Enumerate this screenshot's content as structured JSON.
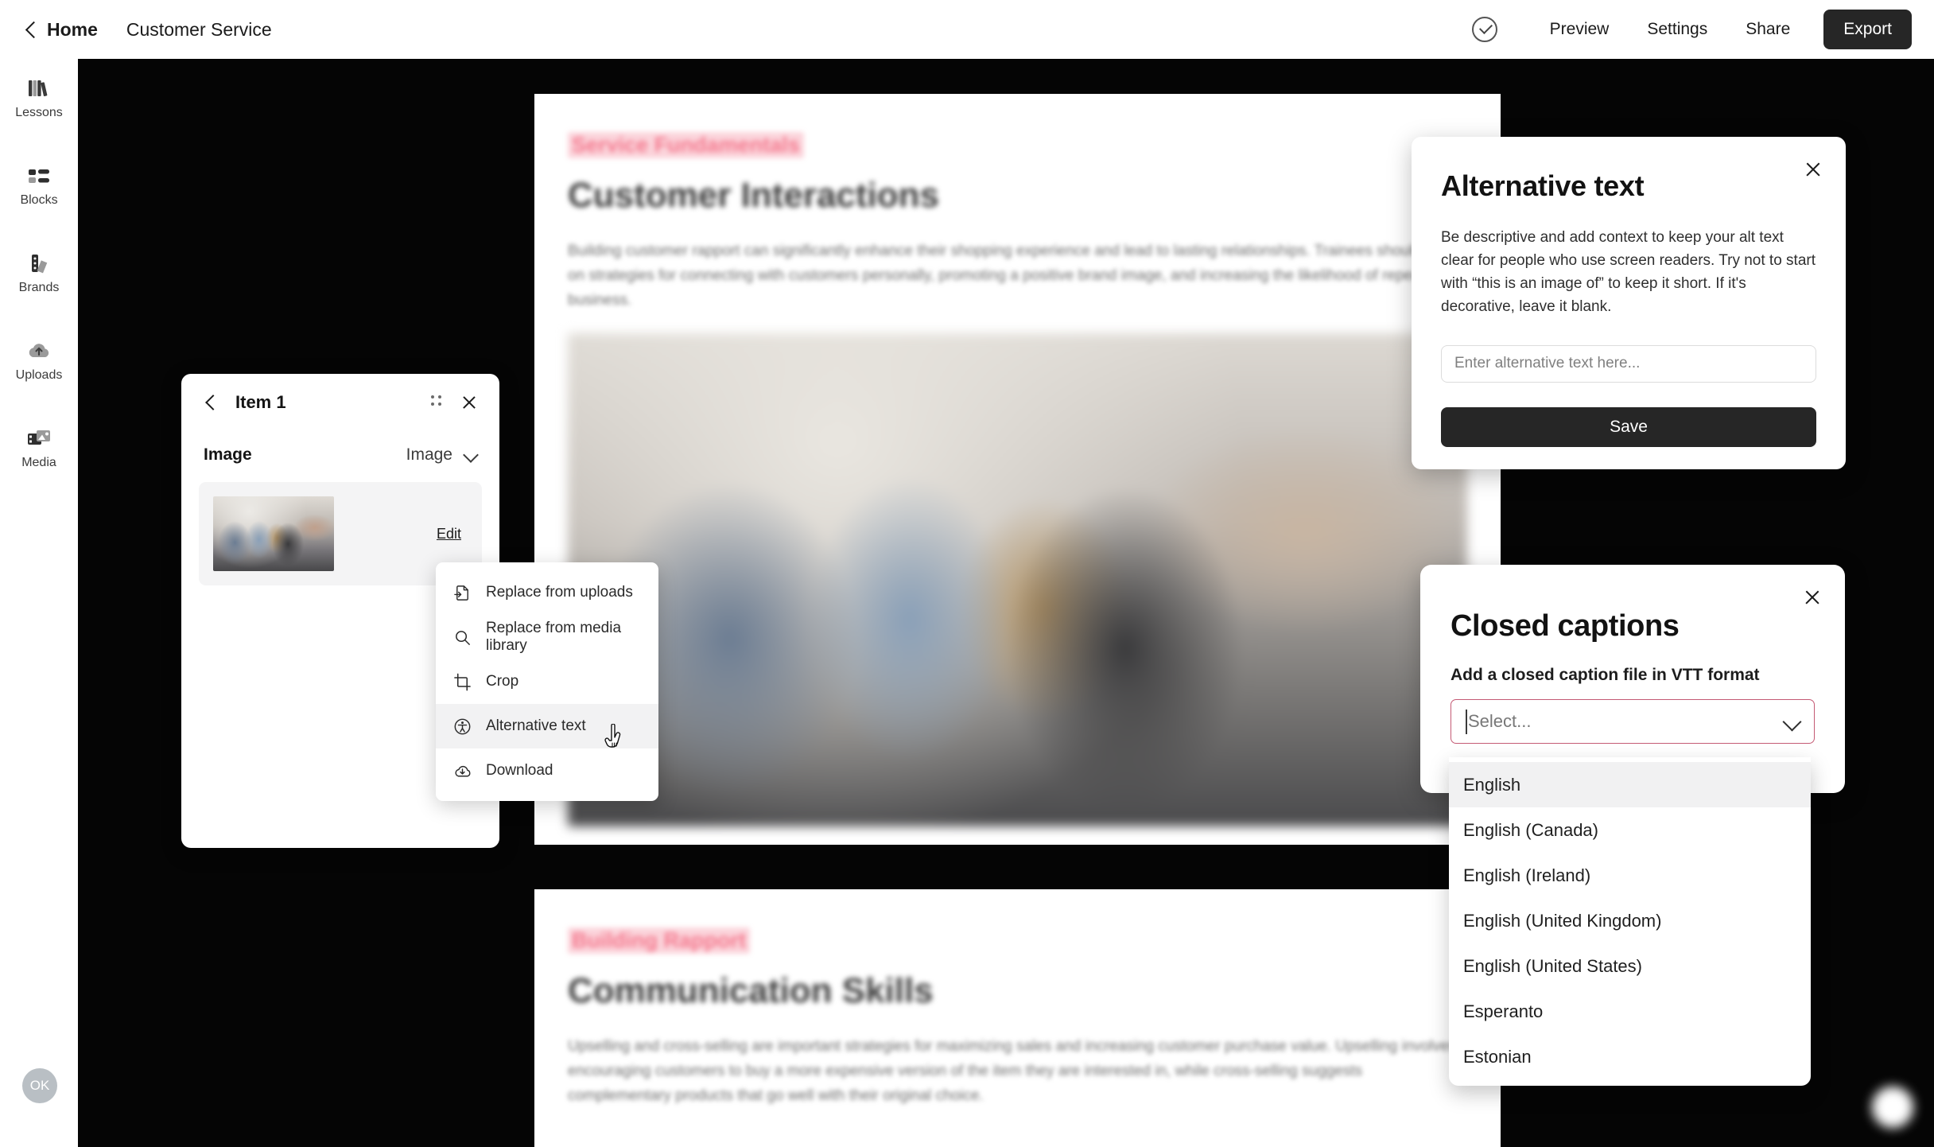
{
  "topbar": {
    "home_label": "Home",
    "breadcrumb": "Customer Service",
    "preview_label": "Preview",
    "settings_label": "Settings",
    "share_label": "Share",
    "export_label": "Export"
  },
  "sidebar": {
    "items": [
      {
        "label": "Lessons",
        "icon": "books-icon"
      },
      {
        "label": "Blocks",
        "icon": "blocks-icon"
      },
      {
        "label": "Brands",
        "icon": "brands-palette-icon"
      },
      {
        "label": "Uploads",
        "icon": "cloud-upload-icon"
      },
      {
        "label": "Media",
        "icon": "media-icon"
      }
    ],
    "avatar_initials": "OK"
  },
  "canvas": {
    "slides": [
      {
        "eyebrow": "Service Fundamentals",
        "title": "Customer Interactions",
        "body": "Building customer rapport can significantly enhance their shopping experience and lead to lasting relationships. Trainees should focus on strategies for connecting with customers personally, promoting a positive brand image, and increasing the likelihood of repeat business."
      },
      {
        "eyebrow": "Building Rapport",
        "title": "Communication Skills",
        "body": "Upselling and cross-selling are important strategies for maximizing sales and increasing customer purchase value. Upselling involves encouraging customers to buy a more expensive version of the item they are interested in, while cross-selling suggests complementary products that go well with their original choice."
      }
    ]
  },
  "item_panel": {
    "title": "Item 1",
    "field_label": "Image",
    "field_value": "Image",
    "edit_label": "Edit",
    "back_icon": "chevron-left-icon",
    "grip_icon": "drag-handle-icon",
    "close_icon": "close-icon"
  },
  "context_menu": {
    "items": [
      {
        "label": "Replace from uploads",
        "icon": "replace-upload-icon",
        "active": false
      },
      {
        "label": "Replace from media library",
        "icon": "search-icon",
        "active": false
      },
      {
        "label": "Crop",
        "icon": "crop-icon",
        "active": false
      },
      {
        "label": "Alternative text",
        "icon": "accessibility-icon",
        "active": true
      },
      {
        "label": "Download",
        "icon": "cloud-download-icon",
        "active": false
      }
    ]
  },
  "alt_dialog": {
    "title": "Alternative text",
    "description": "Be descriptive and add context to keep your alt text clear for people who use screen readers. Try not to start with “this is an image of” to keep it short. If it's decorative, leave it blank.",
    "input_value": "",
    "input_placeholder": "Enter alternative text here...",
    "save_label": "Save",
    "close_icon": "close-icon"
  },
  "closed_captions": {
    "title": "Closed captions",
    "subtitle": "Add a closed caption file in VTT format",
    "select_value": "",
    "select_placeholder": "Select...",
    "select_border_color": "#c45a74",
    "close_icon": "close-icon",
    "chevron_icon": "chevron-down-icon",
    "options": [
      "English",
      "English (Canada)",
      "English (Ireland)",
      "English (United Kingdom)",
      "English (United States)",
      "Esperanto",
      "Estonian"
    ],
    "highlighted_option_index": 0
  },
  "help_bubble": {
    "icon": "chat-help-icon"
  },
  "colors": {
    "canvas_background": "#050505",
    "accent_dark": "#262626",
    "eyebrow_pink": "#f4798e",
    "select_error": "#c45a74"
  }
}
